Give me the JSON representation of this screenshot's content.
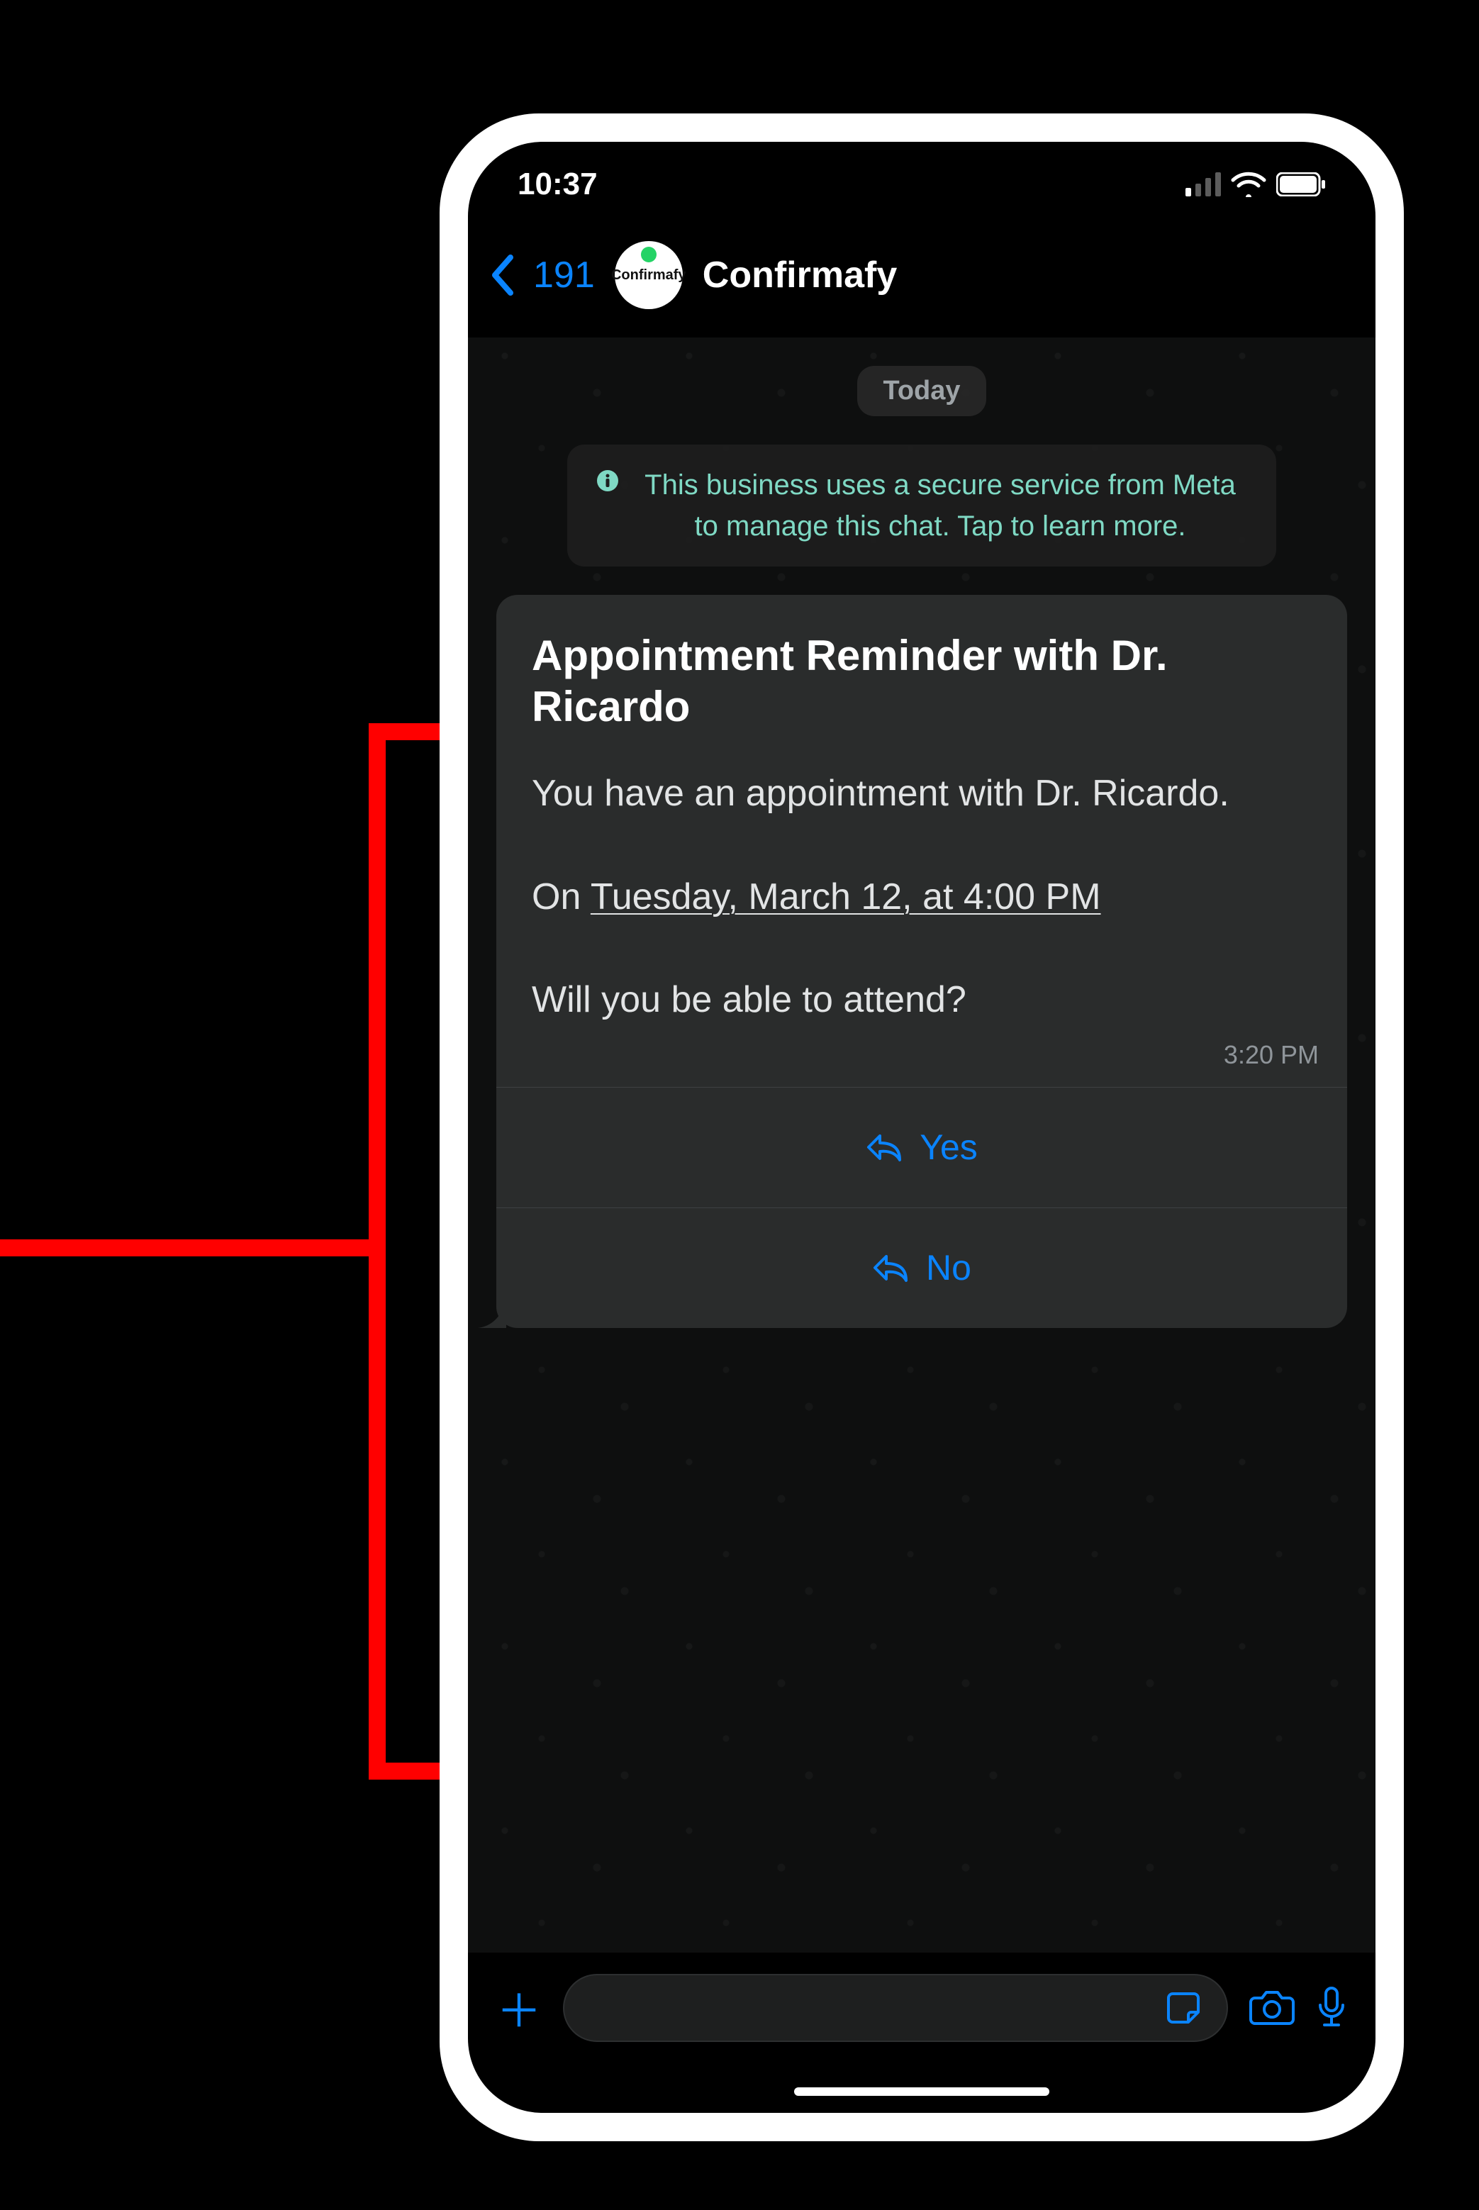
{
  "status": {
    "time": "10:37"
  },
  "header": {
    "back_count": "191",
    "avatar_label": "Confirmafy",
    "contact_name": "Confirmafy"
  },
  "chat": {
    "date_label": "Today",
    "info_banner": "This business uses a secure service from Meta to manage this chat. Tap to learn more."
  },
  "message": {
    "title": "Appointment Reminder with Dr. Ricardo",
    "line1": "You have an appointment with Dr. Ricardo.",
    "line2_prefix": "On ",
    "line2_datetime": "Tuesday, March 12, at 4:00 PM",
    "line3": "Will you be able to attend?",
    "timestamp": "3:20 PM",
    "reply_yes": "Yes",
    "reply_no": "No"
  },
  "colors": {
    "ios_blue": "#0a84ff",
    "teal": "#7fd9c4",
    "bubble": "#2a2c2c"
  }
}
